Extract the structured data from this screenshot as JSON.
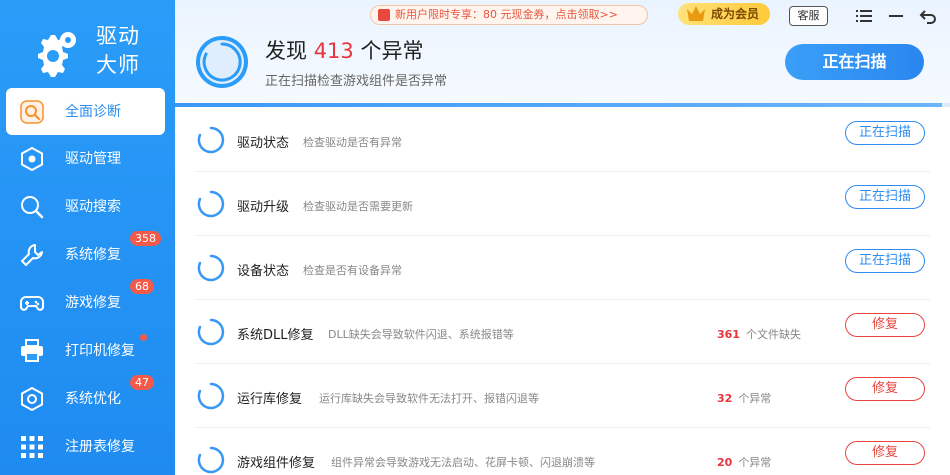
{
  "app": {
    "name_line1": "驱动",
    "name_line2": "大师"
  },
  "sidebar": {
    "items": [
      {
        "label": "全面诊断",
        "icon": "search-diagnose-icon",
        "active": true,
        "badge": ""
      },
      {
        "label": "驱动管理",
        "icon": "hexagon-chip-icon",
        "badge": ""
      },
      {
        "label": "驱动搜索",
        "icon": "magnifier-icon",
        "badge": ""
      },
      {
        "label": "系统修复",
        "icon": "wrench-icon",
        "badge": "358"
      },
      {
        "label": "游戏修复",
        "icon": "gamepad-icon",
        "badge": "68"
      },
      {
        "label": "打印机修复",
        "icon": "printer-icon",
        "badge": "dot"
      },
      {
        "label": "系统优化",
        "icon": "gear-hexagon-icon",
        "badge": "47"
      },
      {
        "label": "注册表修复",
        "icon": "grid-icon",
        "badge": ""
      }
    ]
  },
  "header": {
    "promo": "新用户限时专享：80 元现金券，点击领取>>",
    "vip": "成为会员",
    "service": "客服",
    "title_prefix": "发现",
    "title_count": "413",
    "title_suffix": "个异常",
    "subtitle": "正在扫描检查游戏组件是否异常",
    "scan_button": "正在扫描",
    "progress": 0.99
  },
  "rows": [
    {
      "name": "驱动状态",
      "desc": "检查驱动是否有异常",
      "count": "",
      "count_label": "",
      "button": "正在扫描",
      "button_type": "scanning"
    },
    {
      "name": "驱动升级",
      "desc": "检查驱动是否需要更新",
      "count": "",
      "count_label": "",
      "button": "正在扫描",
      "button_type": "scanning"
    },
    {
      "name": "设备状态",
      "desc": "检查是否有设备异常",
      "count": "",
      "count_label": "",
      "button": "正在扫描",
      "button_type": "scanning"
    },
    {
      "name": "系统DLL修复",
      "desc": "DLL缺失会导致软件闪退、系统报错等",
      "count": "361",
      "count_label": "个文件缺失",
      "button": "修复",
      "button_type": "repair"
    },
    {
      "name": "运行库修复",
      "desc": "运行库缺失会导致软件无法打开、报错闪退等",
      "count": "32",
      "count_label": "个异常",
      "button": "修复",
      "button_type": "repair"
    },
    {
      "name": "游戏组件修复",
      "desc": "组件异常会导致游戏无法启动、花屏卡顿、闪退崩溃等",
      "count": "20",
      "count_label": "个异常",
      "button": "修复",
      "button_type": "repair"
    }
  ],
  "colors": {
    "brand_blue": "#2b9cf8",
    "alert_red": "#e8343d",
    "vip_gold": "#ffc93a"
  }
}
